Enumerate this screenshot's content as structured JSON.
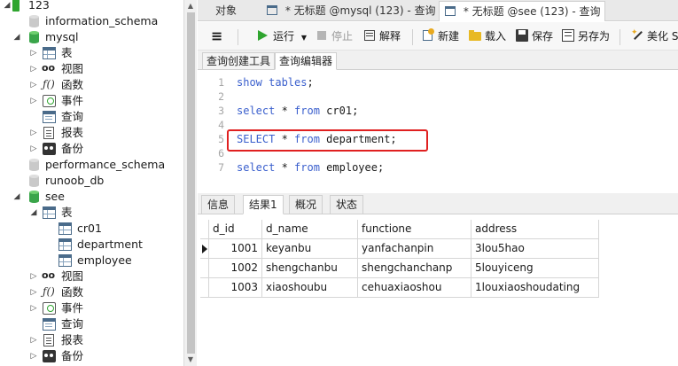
{
  "tree": {
    "connection": "123",
    "databases": [
      {
        "name": "information_schema",
        "expanded": false,
        "color": "gray"
      },
      {
        "name": "mysql",
        "expanded": true,
        "color": "green"
      },
      {
        "name": "performance_schema",
        "expanded": false,
        "color": "gray"
      },
      {
        "name": "runoob_db",
        "expanded": false,
        "color": "gray"
      },
      {
        "name": "see",
        "expanded": true,
        "color": "green"
      }
    ],
    "mysql_children": [
      "表",
      "视图",
      "函数",
      "事件",
      "查询",
      "报表",
      "备份"
    ],
    "see_children": [
      "表",
      "视图",
      "函数",
      "事件",
      "查询",
      "报表",
      "备份"
    ],
    "see_tables": [
      "cr01",
      "department",
      "employee"
    ]
  },
  "tabs": [
    {
      "label": "对象"
    },
    {
      "label": "* 无标题 @mysql (123) - 查询"
    },
    {
      "label": "* 无标题 @see (123) - 查询",
      "active": true
    }
  ],
  "toolbar": {
    "menu": "≡",
    "run": "运行",
    "stop": "停止",
    "explain": "解释",
    "new": "新建",
    "load": "载入",
    "save": "保存",
    "save_as": "另存为",
    "beautify": "美化 S"
  },
  "subtabs": [
    "查询创建工具",
    "查询编辑器"
  ],
  "editor": {
    "lines": [
      {
        "n": "1",
        "kw": "show tables",
        "rest": ";"
      },
      {
        "n": "2",
        "kw": "",
        "rest": ""
      },
      {
        "n": "3",
        "kw": "select",
        "rest": " * ",
        "kw2": "from",
        "rest2": " cr01;"
      },
      {
        "n": "4",
        "kw": "",
        "rest": ""
      },
      {
        "n": "5",
        "kw": "SELECT",
        "rest": " * ",
        "kw2": "from",
        "rest2": " department;"
      },
      {
        "n": "6",
        "kw": "",
        "rest": ""
      },
      {
        "n": "7",
        "kw": "select",
        "rest": " * ",
        "kw2": "from",
        "rest2": " employee;"
      }
    ]
  },
  "result_tabs": [
    "信息",
    "结果1",
    "概况",
    "状态"
  ],
  "result": {
    "columns": [
      "d_id",
      "d_name",
      "functione",
      "address"
    ],
    "rows": [
      [
        "1001",
        "keyanbu",
        "yanfachanpin",
        "3lou5hao"
      ],
      [
        "1002",
        "shengchanbu",
        "shengchanchanp",
        "5louyiceng"
      ],
      [
        "1003",
        "xiaoshoubu",
        "cehuaxiaoshou",
        "1louxiaoshoudating"
      ]
    ]
  },
  "colors": {
    "keyword": "#3a5fcd",
    "highlight": "#e02020",
    "run_green": "#2fa52f"
  }
}
